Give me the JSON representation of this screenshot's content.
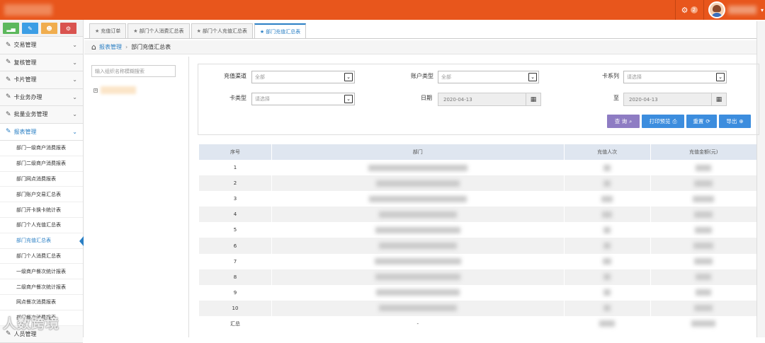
{
  "header": {
    "notification_count": "2"
  },
  "sidebar": {
    "shortcut_colors": [
      "#5cb85c",
      "#3c9ee5",
      "#f0ad4e",
      "#d9534f"
    ],
    "menu_top": [
      {
        "label": "交易管理"
      },
      {
        "label": "复核管理"
      },
      {
        "label": "卡片管理"
      },
      {
        "label": "卡业务办理"
      },
      {
        "label": "批量业务管理"
      },
      {
        "label": "报表管理"
      }
    ],
    "sub_items": [
      {
        "label": "部门一级商户消费报表"
      },
      {
        "label": "部门二级商户消费报表"
      },
      {
        "label": "部门网点消费报表"
      },
      {
        "label": "部门账户交易汇总表"
      },
      {
        "label": "部门开卡换卡统计表"
      },
      {
        "label": "部门个人充值汇总表"
      },
      {
        "label": "部门充值汇总表"
      },
      {
        "label": "部门个人消费汇总表"
      },
      {
        "label": "一级商户餐次统计报表"
      },
      {
        "label": "二级商户餐次统计报表"
      },
      {
        "label": "网点餐次消费报表"
      },
      {
        "label": "部门餐次消费报表"
      }
    ],
    "menu_bottom": {
      "label": "人员管理"
    }
  },
  "watermark": "人数跨境",
  "tabs": [
    {
      "label": "充值订单"
    },
    {
      "label": "部门个人消费汇总表"
    },
    {
      "label": "部门个人充值汇总表"
    },
    {
      "label": "部门充值汇总表"
    }
  ],
  "breadcrumb": {
    "parent": "报表管理",
    "current": "部门充值汇总表"
  },
  "tree": {
    "search_placeholder": "输入组织名称模糊搜索"
  },
  "filters": {
    "channel_label": "充值渠道",
    "channel_value": "全部",
    "account_type_label": "账户类型",
    "account_type_value": "全部",
    "card_series_label": "卡系列",
    "card_series_value": "请选择",
    "card_type_label": "卡类型",
    "card_type_value": "请选择",
    "date_label": "日期",
    "date_from": "2020-04-13",
    "to_label": "至",
    "date_to": "2020-04-13"
  },
  "buttons": {
    "query": "查 询",
    "print_preview": "打印预览",
    "reset": "重置",
    "export": "导出",
    "query_color": "#8e7cc3",
    "action_color": "#3c8dde"
  },
  "table": {
    "headers": {
      "seq": "序号",
      "dept": "部门",
      "count": "充值人次",
      "amount": "充值金额(元)"
    },
    "rows": [
      {
        "seq": "1"
      },
      {
        "seq": "2"
      },
      {
        "seq": "3"
      },
      {
        "seq": "4"
      },
      {
        "seq": "5"
      },
      {
        "seq": "6"
      },
      {
        "seq": "7"
      },
      {
        "seq": "8"
      },
      {
        "seq": "9"
      },
      {
        "seq": "10"
      }
    ],
    "summary": {
      "label": "汇总",
      "dept": "-"
    }
  }
}
